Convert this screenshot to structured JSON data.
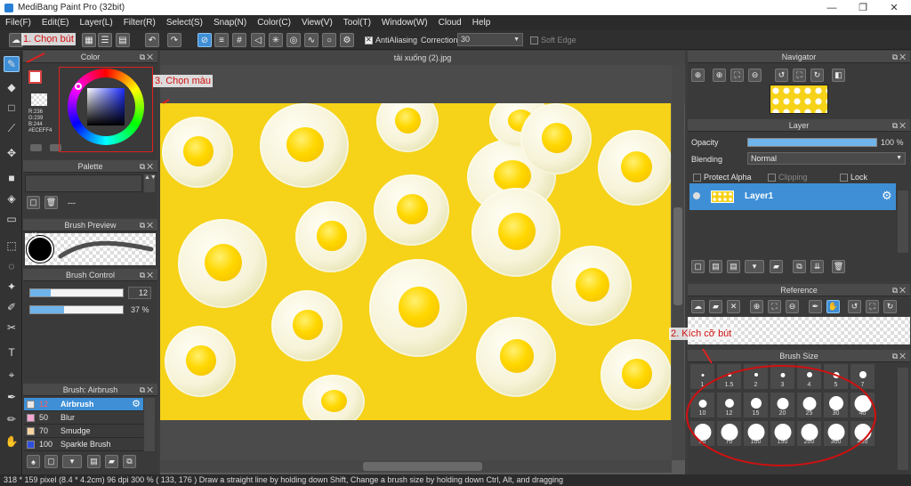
{
  "window": {
    "title": "MediBang Paint Pro (32bit)",
    "minimize": "—",
    "maximize": "❐",
    "close": "✕"
  },
  "menu": [
    "File(F)",
    "Edit(E)",
    "Layer(L)",
    "Filter(R)",
    "Select(S)",
    "Snap(N)",
    "Color(C)",
    "View(V)",
    "Tool(T)",
    "Window(W)",
    "Cloud",
    "Help"
  ],
  "toolbar": {
    "antialias_label": "AntiAliasing",
    "correction_label": "Correction",
    "correction_value": "30",
    "soft_edge_label": "Soft Edge"
  },
  "panels": {
    "color": {
      "title": "Color",
      "rgb": [
        "R:236",
        "G:239",
        "B:244"
      ],
      "hex": "#ECEFF4"
    },
    "palette": {
      "title": "Palette",
      "empty_text": "---"
    },
    "brush_preview": {
      "title": "Brush Preview",
      "size_text": "12"
    },
    "brush_control": {
      "title": "Brush Control",
      "size_value": "12",
      "opacity_value": "37 %",
      "size_fraction": 0.22,
      "opacity_fraction": 0.37
    },
    "brush_list": {
      "title": "Brush: Airbrush",
      "items": [
        {
          "size": "12",
          "name": "Airbrush",
          "color": "#3e8fd6",
          "swatch": "#e8e8e8"
        },
        {
          "size": "50",
          "name": "Blur",
          "color": "#3a3a3a",
          "swatch": "#f5a6d2"
        },
        {
          "size": "70",
          "name": "Smudge",
          "color": "#3a3a3a",
          "swatch": "#f7d4a0"
        },
        {
          "size": "100",
          "name": "Sparkle Brush",
          "color": "#3a3a3a",
          "swatch": "#3050e0"
        }
      ]
    },
    "canvas": {
      "tab_title": "tải xuống (2).jpg"
    },
    "navigator": {
      "title": "Navigator"
    },
    "layer": {
      "title": "Layer",
      "opacity_label": "Opacity",
      "opacity_value": "100 %",
      "opacity_fraction": 1.0,
      "blending_label": "Blending",
      "blending_value": "Normal",
      "protect_alpha": "Protect Alpha",
      "clipping": "Clipping",
      "lock": "Lock",
      "layer_name": "Layer1"
    },
    "reference": {
      "title": "Reference"
    },
    "brush_size": {
      "title": "Brush Size",
      "sizes": [
        "1",
        "1.5",
        "2",
        "3",
        "4",
        "5",
        "7",
        "10",
        "12",
        "15",
        "20",
        "25",
        "30",
        "40",
        "50",
        "70",
        "100",
        "150",
        "200",
        "300",
        "400"
      ]
    }
  },
  "annotations": {
    "step1": "1. Chọn bút",
    "step2": "2. Kích cỡ bút",
    "step3": "3. Chọn màu"
  },
  "status": {
    "size": "318 * 159 pixel",
    "physical": "(8.4 * 4.2cm)",
    "dpi": "96 dpi",
    "zoom": "300 %",
    "coords": "( 133, 176 )",
    "hint": "Draw a straight line by holding down Shift, Change a brush size by holding down Ctrl, Alt, and dragging"
  },
  "colors": {
    "accent": "#3e8fd6",
    "canvas_bg": "#f6d218",
    "annotation": "#d01010"
  }
}
